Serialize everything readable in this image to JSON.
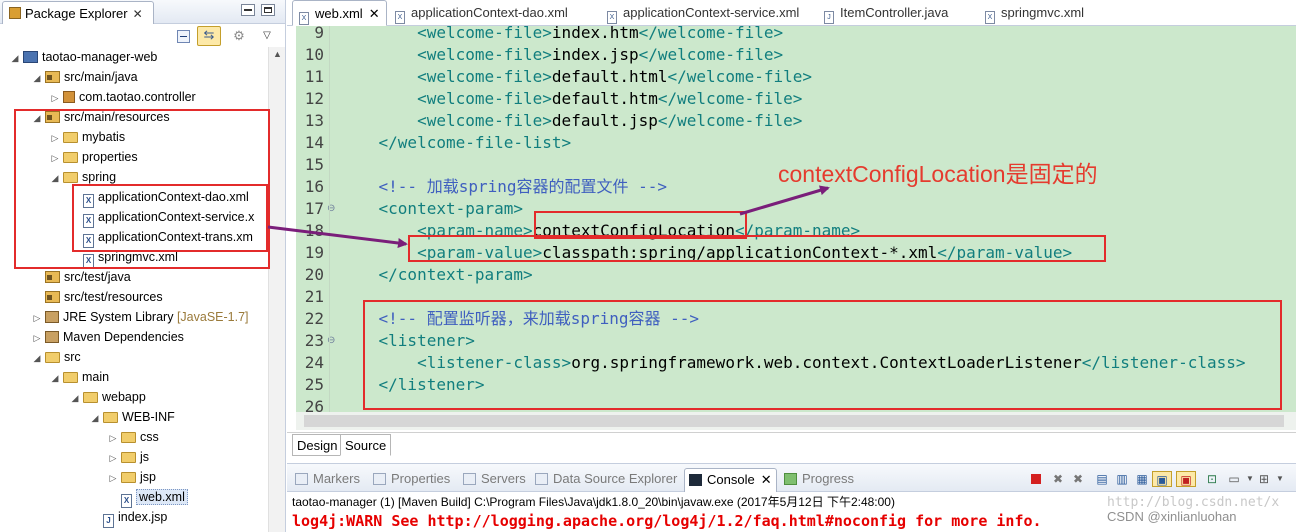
{
  "package_explorer": {
    "tab_title": "Package Explorer",
    "tree": [
      {
        "label": "taotao-manager-web",
        "twisty": "expanded",
        "icon": "project-icon",
        "extra": ""
      },
      {
        "label": "src/main/java",
        "twisty": "expanded",
        "icon": "source-folder-icon",
        "extra": ""
      },
      {
        "label": "com.taotao.controller",
        "twisty": "collapsed",
        "icon": "package-icon",
        "extra": ""
      },
      {
        "label": "src/main/resources",
        "twisty": "expanded",
        "icon": "source-folder-icon",
        "extra": ""
      },
      {
        "label": "mybatis",
        "twisty": "collapsed",
        "icon": "folder-icon",
        "extra": ""
      },
      {
        "label": "properties",
        "twisty": "collapsed",
        "icon": "folder-icon",
        "extra": ""
      },
      {
        "label": "spring",
        "twisty": "expanded",
        "icon": "folder-icon",
        "extra": ""
      },
      {
        "label": "applicationContext-dao.xml",
        "twisty": "",
        "icon": "xml-file-icon",
        "extra": ""
      },
      {
        "label": "applicationContext-service.x",
        "twisty": "",
        "icon": "xml-file-icon",
        "extra": ""
      },
      {
        "label": "applicationContext-trans.xm",
        "twisty": "",
        "icon": "xml-file-icon",
        "extra": ""
      },
      {
        "label": "springmvc.xml",
        "twisty": "",
        "icon": "xml-file-icon",
        "extra": ""
      },
      {
        "label": "src/test/java",
        "twisty": "",
        "icon": "source-folder-icon",
        "extra": ""
      },
      {
        "label": "src/test/resources",
        "twisty": "",
        "icon": "source-folder-icon",
        "extra": ""
      },
      {
        "label": "JRE System Library",
        "twisty": "collapsed",
        "icon": "library-icon",
        "extra": "[JavaSE-1.7]"
      },
      {
        "label": "Maven Dependencies",
        "twisty": "collapsed",
        "icon": "library-icon",
        "extra": ""
      },
      {
        "label": "src",
        "twisty": "expanded",
        "icon": "folder-icon",
        "extra": ""
      },
      {
        "label": "main",
        "twisty": "expanded",
        "icon": "folder-icon",
        "extra": ""
      },
      {
        "label": "webapp",
        "twisty": "expanded",
        "icon": "folder-icon",
        "extra": ""
      },
      {
        "label": "WEB-INF",
        "twisty": "expanded",
        "icon": "folder-icon",
        "extra": ""
      },
      {
        "label": "css",
        "twisty": "collapsed",
        "icon": "folder-icon",
        "extra": ""
      },
      {
        "label": "js",
        "twisty": "collapsed",
        "icon": "folder-icon",
        "extra": ""
      },
      {
        "label": "jsp",
        "twisty": "collapsed",
        "icon": "folder-icon",
        "extra": ""
      },
      {
        "label": "web.xml",
        "twisty": "",
        "icon": "xml-file-icon",
        "extra": ""
      },
      {
        "label": "index.jsp",
        "twisty": "",
        "icon": "jsp-file-icon",
        "extra": ""
      }
    ]
  },
  "editor": {
    "tabs": [
      {
        "label": "web.xml",
        "active": true
      },
      {
        "label": "applicationContext-dao.xml",
        "active": false
      },
      {
        "label": "applicationContext-service.xml",
        "active": false
      },
      {
        "label": "ItemController.java",
        "active": false
      },
      {
        "label": "springmvc.xml",
        "active": false
      }
    ],
    "lines": [
      {
        "n": "9",
        "parts": [
          [
            "tag",
            "        <welcome-file>"
          ],
          [
            "txt",
            "index.htm"
          ],
          [
            "tag",
            "</welcome-file>"
          ]
        ]
      },
      {
        "n": "10",
        "parts": [
          [
            "tag",
            "        <welcome-file>"
          ],
          [
            "txt",
            "index.jsp"
          ],
          [
            "tag",
            "</welcome-file>"
          ]
        ]
      },
      {
        "n": "11",
        "parts": [
          [
            "tag",
            "        <welcome-file>"
          ],
          [
            "txt",
            "default.html"
          ],
          [
            "tag",
            "</welcome-file>"
          ]
        ]
      },
      {
        "n": "12",
        "parts": [
          [
            "tag",
            "        <welcome-file>"
          ],
          [
            "txt",
            "default.htm"
          ],
          [
            "tag",
            "</welcome-file>"
          ]
        ]
      },
      {
        "n": "13",
        "parts": [
          [
            "tag",
            "        <welcome-file>"
          ],
          [
            "txt",
            "default.jsp"
          ],
          [
            "tag",
            "</welcome-file>"
          ]
        ]
      },
      {
        "n": "14",
        "parts": [
          [
            "tag",
            "    </welcome-file-list>"
          ]
        ]
      },
      {
        "n": "15",
        "parts": []
      },
      {
        "n": "16",
        "parts": [
          [
            "cmt",
            "    <!-- 加载spring容器的配置文件 -->"
          ]
        ]
      },
      {
        "n": "17",
        "parts": [
          [
            "tag",
            "    <context-param>"
          ]
        ],
        "fold": true
      },
      {
        "n": "18",
        "parts": [
          [
            "tag",
            "        <param-name>"
          ],
          [
            "txt",
            "contextConfigLocation"
          ],
          [
            "tag",
            "</param-name>"
          ]
        ]
      },
      {
        "n": "19",
        "parts": [
          [
            "tag",
            "        <param-value>"
          ],
          [
            "txt",
            "classpath:spring/applicationContext-*.xml"
          ],
          [
            "tag",
            "</param-value>"
          ]
        ]
      },
      {
        "n": "20",
        "parts": [
          [
            "tag",
            "    </context-param>"
          ]
        ]
      },
      {
        "n": "21",
        "parts": []
      },
      {
        "n": "22",
        "parts": [
          [
            "cmt",
            "    <!-- 配置监听器，来加载spring容器 -->"
          ]
        ]
      },
      {
        "n": "23",
        "parts": [
          [
            "tag",
            "    <listener>"
          ]
        ],
        "fold": true
      },
      {
        "n": "24",
        "parts": [
          [
            "tag",
            "        <listener-class>"
          ],
          [
            "txt",
            "org.springframework.web.context.ContextLoaderListener"
          ],
          [
            "tag",
            "</listener-class>"
          ]
        ]
      },
      {
        "n": "25",
        "parts": [
          [
            "tag",
            "    </listener>"
          ]
        ]
      },
      {
        "n": "26",
        "parts": []
      }
    ],
    "design_tab": "Design",
    "source_tab": "Source"
  },
  "annotation": {
    "text": "contextConfigLocation是固定的",
    "color": "#e53b2e"
  },
  "console": {
    "tabs": [
      "Markers",
      "Properties",
      "Servers",
      "Data Source Explorer",
      "Console",
      "Progress"
    ],
    "active_tab": "Console",
    "title": "taotao-manager (1) [Maven Build] C:\\Program Files\\Java\\jdk1.8.0_20\\bin\\javaw.exe (2017年5月12日 下午2:48:00)",
    "output_line": "log4j:WARN See http://logging.apache.org/log4j/1.2/faq.html#noconfig for more info.",
    "watermark_url": "http://blog.csdn.net/x",
    "watermark": "CSDN @xinlianluohan"
  }
}
